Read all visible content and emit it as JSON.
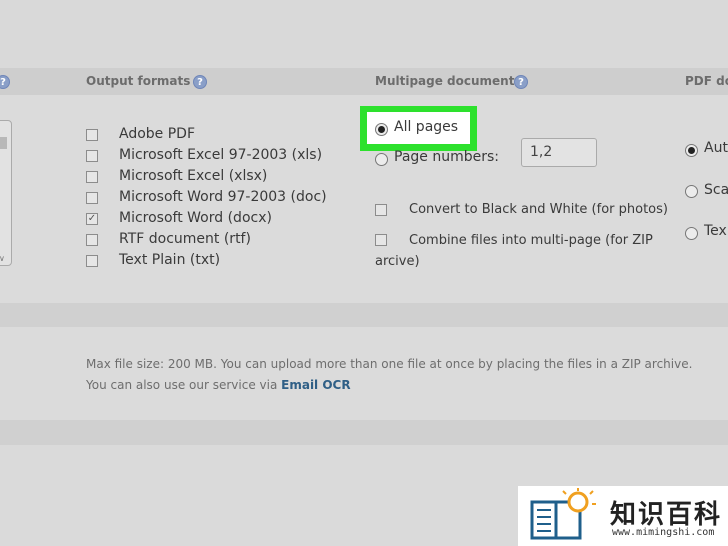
{
  "columns": {
    "output_formats": "Output formats",
    "multipage": "Multipage document",
    "pdf": "PDF do"
  },
  "help_glyph": "?",
  "formats": [
    {
      "label": "Adobe PDF",
      "checked": false
    },
    {
      "label": "Microsoft Excel 97-2003 (xls)",
      "checked": false
    },
    {
      "label": "Microsoft Excel (xlsx)",
      "checked": false
    },
    {
      "label": "Microsoft Word 97-2003 (doc)",
      "checked": false
    },
    {
      "label": "Microsoft Word (docx)",
      "checked": true
    },
    {
      "label": "RTF document (rtf)",
      "checked": false
    },
    {
      "label": "Text Plain (txt)",
      "checked": false
    }
  ],
  "multipage": {
    "all_pages": "All pages",
    "page_numbers": "Page numbers:",
    "page_numbers_value": "1,2",
    "convert_bw": "Convert to Black and White (for photos)",
    "combine_line1": "Combine files into multi-page (for ZIP",
    "combine_line2": "arcive)"
  },
  "pdf_options": [
    "Aut",
    "Sca",
    "Tex"
  ],
  "info": {
    "max_size": "Max file size: 200 MB. You can upload more than one file at once by placing the files in a ZIP archive.",
    "service_prefix": "You can also use our service via",
    "service_link": "Email OCR"
  },
  "watermark": {
    "chinese": "知识百科",
    "url": "www.mimingshi.com"
  },
  "colors": {
    "highlight": "#2de12d",
    "link": "#2f5f86",
    "help": "#8a9fc8"
  }
}
